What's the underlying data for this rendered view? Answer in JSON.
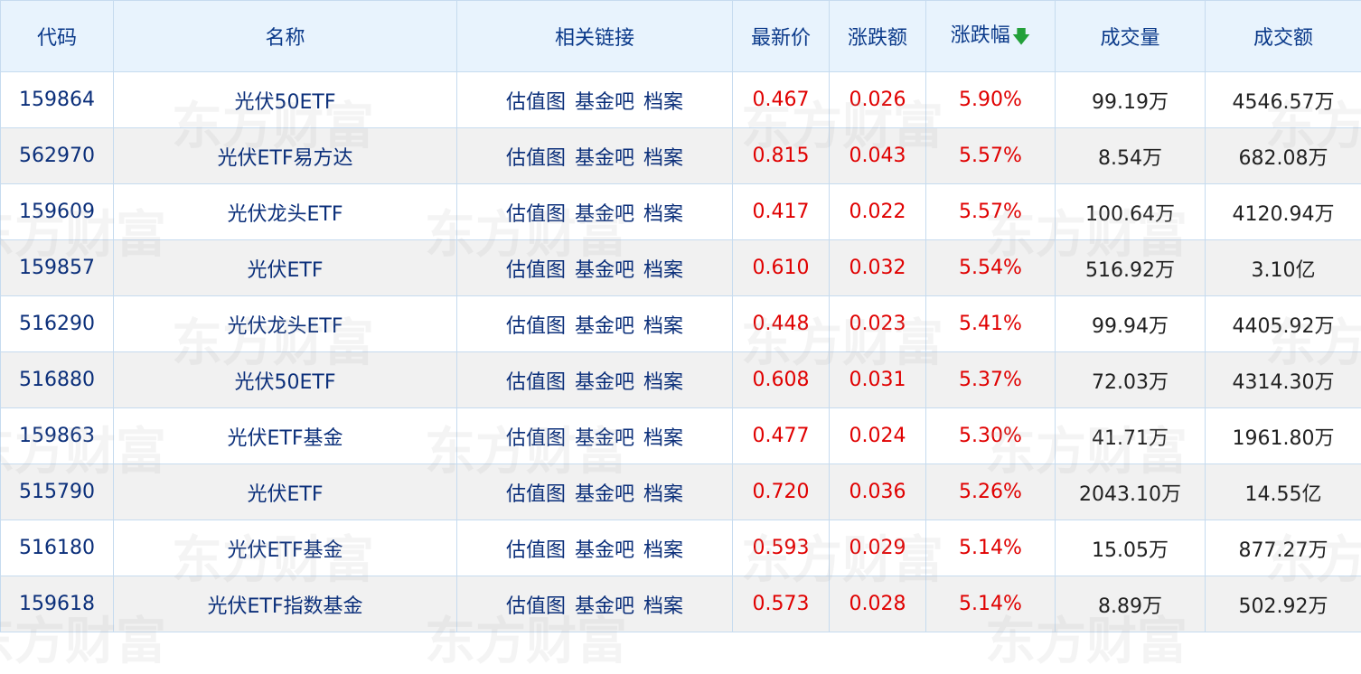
{
  "table": {
    "headers": {
      "code": "代码",
      "name": "名称",
      "links": "相关链接",
      "price": "最新价",
      "change": "涨跌额",
      "pct": "涨跌幅",
      "volume": "成交量",
      "amount": "成交额"
    },
    "sort_icon": "down-arrow-icon",
    "colors": {
      "header_bg": "#e8f3fd",
      "up": "#e00000",
      "sort_arrow": "#23a03a",
      "link": "#0b2f7a"
    },
    "rows": [
      {
        "code": "159864",
        "name": "光伏50ETF",
        "l1": "估值图",
        "l2": "基金吧",
        "l3": "档案",
        "price": "0.467",
        "change": "0.026",
        "pct": "5.90%",
        "volume": "99.19万",
        "amount": "4546.57万"
      },
      {
        "code": "562970",
        "name": "光伏ETF易方达",
        "l1": "估值图",
        "l2": "基金吧",
        "l3": "档案",
        "price": "0.815",
        "change": "0.043",
        "pct": "5.57%",
        "volume": "8.54万",
        "amount": "682.08万"
      },
      {
        "code": "159609",
        "name": "光伏龙头ETF",
        "l1": "估值图",
        "l2": "基金吧",
        "l3": "档案",
        "price": "0.417",
        "change": "0.022",
        "pct": "5.57%",
        "volume": "100.64万",
        "amount": "4120.94万"
      },
      {
        "code": "159857",
        "name": "光伏ETF",
        "l1": "估值图",
        "l2": "基金吧",
        "l3": "档案",
        "price": "0.610",
        "change": "0.032",
        "pct": "5.54%",
        "volume": "516.92万",
        "amount": "3.10亿"
      },
      {
        "code": "516290",
        "name": "光伏龙头ETF",
        "l1": "估值图",
        "l2": "基金吧",
        "l3": "档案",
        "price": "0.448",
        "change": "0.023",
        "pct": "5.41%",
        "volume": "99.94万",
        "amount": "4405.92万"
      },
      {
        "code": "516880",
        "name": "光伏50ETF",
        "l1": "估值图",
        "l2": "基金吧",
        "l3": "档案",
        "price": "0.608",
        "change": "0.031",
        "pct": "5.37%",
        "volume": "72.03万",
        "amount": "4314.30万"
      },
      {
        "code": "159863",
        "name": "光伏ETF基金",
        "l1": "估值图",
        "l2": "基金吧",
        "l3": "档案",
        "price": "0.477",
        "change": "0.024",
        "pct": "5.30%",
        "volume": "41.71万",
        "amount": "1961.80万"
      },
      {
        "code": "515790",
        "name": "光伏ETF",
        "l1": "估值图",
        "l2": "基金吧",
        "l3": "档案",
        "price": "0.720",
        "change": "0.036",
        "pct": "5.26%",
        "volume": "2043.10万",
        "amount": "14.55亿"
      },
      {
        "code": "516180",
        "name": "光伏ETF基金",
        "l1": "估值图",
        "l2": "基金吧",
        "l3": "档案",
        "price": "0.593",
        "change": "0.029",
        "pct": "5.14%",
        "volume": "15.05万",
        "amount": "877.27万"
      },
      {
        "code": "159618",
        "name": "光伏ETF指数基金",
        "l1": "估值图",
        "l2": "基金吧",
        "l3": "档案",
        "price": "0.573",
        "change": "0.028",
        "pct": "5.14%",
        "volume": "8.89万",
        "amount": "502.92万"
      }
    ]
  },
  "watermark": "东方财富"
}
